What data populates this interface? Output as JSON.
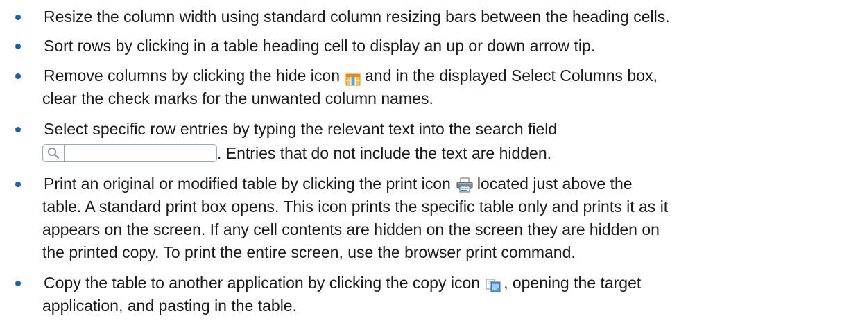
{
  "items": [
    {
      "text": "Resize the column width using standard column resizing bars between the heading cells."
    },
    {
      "text": "Sort rows by clicking in a table heading cell to display an up or down arrow tip."
    },
    {
      "before_icon": "Remove columns by clicking the hide icon",
      "icon": "hide-columns-icon",
      "after_icon": "and in the displayed Select Columns box,",
      "line2": "clear the check marks for the unwanted column names."
    },
    {
      "line1": "Select specific row entries by typing the relevant text into the search field",
      "search_icon": "magnifier-icon",
      "after_field": ". Entries that do not include the text are hidden."
    },
    {
      "before_icon": "Print an original or modified table by clicking the print icon",
      "icon": "printer-icon",
      "after_icon": "located just above the",
      "line2": "table. A standard print box opens. This icon prints the specific table only and prints it as it",
      "line3": "appears on the screen. If any cell contents are hidden on the screen they are hidden on",
      "line4": "the printed copy. To print the entire screen, use the browser print command."
    },
    {
      "before_icon": "Copy the table to another application by clicking the copy icon",
      "icon": "copy-icon",
      "after_icon": ", opening the target",
      "line2": "application, and pasting in the table."
    }
  ],
  "colors": {
    "bullet": "#1f5fae",
    "text": "#1a1a1a",
    "search_border": "#9fa6ad"
  }
}
